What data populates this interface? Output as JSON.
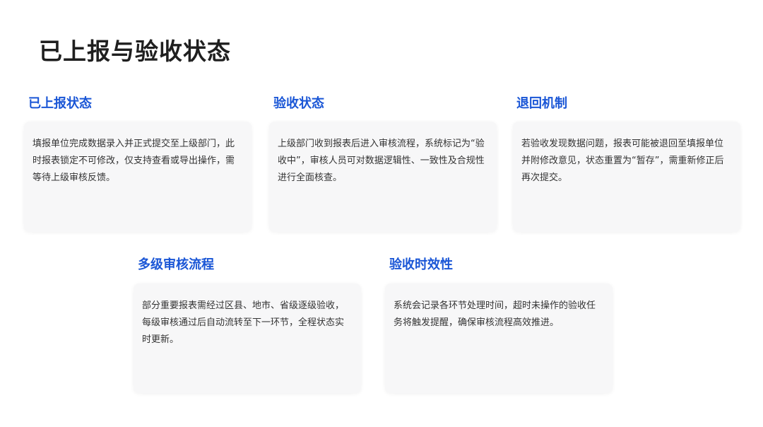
{
  "page": {
    "title": "已上报与验收状态"
  },
  "sections": [
    {
      "heading": "已上报状态",
      "text": "填报单位完成数据录入并正式提交至上级部门，此时报表锁定不可修改，仅支持查看或导出操作，需等待上级审核反馈。"
    },
    {
      "heading": "验收状态",
      "text": "上级部门收到报表后进入审核流程，系统标记为“验收中”，审核人员可对数据逻辑性、一致性及合规性进行全面核查。"
    },
    {
      "heading": "退回机制",
      "text": "若验收发现数据问题，报表可能被退回至填报单位并附修改意见，状态重置为“暂存”，需重新修正后再次提交。"
    },
    {
      "heading": "多级审核流程",
      "text": "部分重要报表需经过区县、地市、省级逐级验收，每级审核通过后自动流转至下一环节，全程状态实时更新。"
    },
    {
      "heading": "验收时效性",
      "text": "系统会记录各环节处理时间，超时未操作的验收任务将触发提醒，确保审核流程高效推进。"
    }
  ],
  "colors": {
    "heading_accent": "#1a56d6",
    "title": "#1f1f1f",
    "card_background": "#f7f7f8",
    "body_text": "#333333"
  }
}
